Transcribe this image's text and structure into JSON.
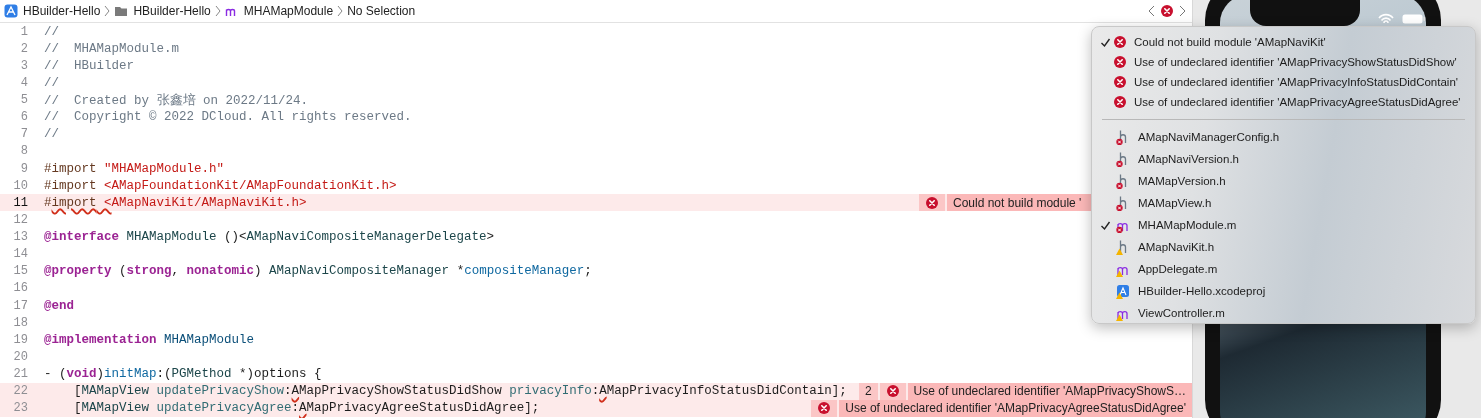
{
  "breadcrumb": {
    "items": [
      {
        "label": "HBuilder-Hello",
        "kind": "project"
      },
      {
        "label": "HBuilder-Hello",
        "kind": "folder"
      },
      {
        "label": "MHAMapModule",
        "kind": "source"
      },
      {
        "label": "No Selection",
        "kind": "symbol"
      }
    ]
  },
  "editor": {
    "lines": [
      {
        "number": "1",
        "current": false,
        "error": false,
        "segments": [
          {
            "text": "//",
            "kind": "comment"
          }
        ]
      },
      {
        "number": "2",
        "current": false,
        "error": false,
        "segments": [
          {
            "text": "//  MHAMapModule.m",
            "kind": "comment"
          }
        ]
      },
      {
        "number": "3",
        "current": false,
        "error": false,
        "segments": [
          {
            "text": "//  HBuilder",
            "kind": "comment"
          }
        ]
      },
      {
        "number": "4",
        "current": false,
        "error": false,
        "segments": [
          {
            "text": "//",
            "kind": "comment"
          }
        ]
      },
      {
        "number": "5",
        "current": false,
        "error": false,
        "segments": [
          {
            "text": "//  Created by 张鑫培 on 2022/11/24.",
            "kind": "comment"
          }
        ]
      },
      {
        "number": "6",
        "current": false,
        "error": false,
        "segments": [
          {
            "text": "//  Copyright © 2022 DCloud. All rights reserved.",
            "kind": "comment"
          }
        ]
      },
      {
        "number": "7",
        "current": false,
        "error": false,
        "segments": [
          {
            "text": "//",
            "kind": "comment"
          }
        ]
      },
      {
        "number": "8",
        "current": false,
        "error": false
      },
      {
        "number": "9",
        "current": false,
        "error": false,
        "segments": [
          {
            "text": "#import ",
            "kind": "preproc"
          },
          {
            "text": "\"MHAMapModule.h\"",
            "kind": "string"
          }
        ]
      },
      {
        "number": "10",
        "current": false,
        "error": false,
        "segments": [
          {
            "text": "#import ",
            "kind": "preproc"
          },
          {
            "text": "<AMapFoundationKit/AMapFoundationKit.h>",
            "kind": "string"
          }
        ]
      },
      {
        "number": "11",
        "current": true,
        "error": true,
        "segments": [
          {
            "text": "#",
            "kind": "preproc"
          },
          {
            "text": "import",
            "kind": "preproc_squiggle"
          },
          {
            "text": " <",
            "kind": "string_squiggle"
          },
          {
            "text": "AMapNaviKit/",
            "kind": "string"
          },
          {
            "text": "AMapNaviKit",
            "kind": "string_selected"
          },
          {
            "text": ".h>",
            "kind": "string"
          }
        ],
        "annotation": {
          "message": "Could not build module '"
        }
      },
      {
        "number": "12",
        "current": false,
        "error": false
      },
      {
        "number": "13",
        "current": false,
        "error": false,
        "segments": [
          {
            "text": "@interface",
            "kind": "keyword"
          },
          {
            "text": " MHAMapModule",
            "kind": "type"
          },
          {
            "text": " ()<",
            "kind": "plain"
          },
          {
            "text": "AMapNaviCompositeManagerDelegate",
            "kind": "type"
          },
          {
            "text": ">",
            "kind": "plain"
          }
        ]
      },
      {
        "number": "14",
        "current": false,
        "error": false
      },
      {
        "number": "15",
        "current": false,
        "error": false,
        "segments": [
          {
            "text": "@property",
            "kind": "keyword"
          },
          {
            "text": " (",
            "kind": "plain"
          },
          {
            "text": "strong",
            "kind": "keyword"
          },
          {
            "text": ", ",
            "kind": "plain"
          },
          {
            "text": "nonatomic",
            "kind": "keyword"
          },
          {
            "text": ") ",
            "kind": "plain"
          },
          {
            "text": "AMapNaviCompositeManager",
            "kind": "type"
          },
          {
            "text": " *",
            "kind": "plain"
          },
          {
            "text": "compositeManager",
            "kind": "ident"
          },
          {
            "text": ";",
            "kind": "plain"
          }
        ]
      },
      {
        "number": "16",
        "current": false,
        "error": false
      },
      {
        "number": "17",
        "current": false,
        "error": false,
        "segments": [
          {
            "text": "@end",
            "kind": "keyword"
          }
        ]
      },
      {
        "number": "18",
        "current": false,
        "error": false
      },
      {
        "number": "19",
        "current": false,
        "error": false,
        "segments": [
          {
            "text": "@implementation",
            "kind": "keyword"
          },
          {
            "text": " MHAMapModule",
            "kind": "class"
          }
        ]
      },
      {
        "number": "20",
        "current": false,
        "error": false
      },
      {
        "number": "21",
        "current": false,
        "error": false,
        "segments": [
          {
            "text": "- (",
            "kind": "plain"
          },
          {
            "text": "void",
            "kind": "keyword"
          },
          {
            "text": ")",
            "kind": "plain"
          },
          {
            "text": "initMap",
            "kind": "ident"
          },
          {
            "text": ":(",
            "kind": "plain"
          },
          {
            "text": "PGMethod",
            "kind": "type"
          },
          {
            "text": " *)options {",
            "kind": "plain"
          }
        ]
      },
      {
        "number": "22",
        "current": false,
        "error": true,
        "segments": [
          {
            "text": "    [",
            "kind": "plain"
          },
          {
            "text": "MAMapView",
            "kind": "type"
          },
          {
            "text": " updatePrivacyShow",
            "kind": "method"
          },
          {
            "text": ":",
            "kind": "plain"
          },
          {
            "text": "A",
            "kind": "plain_squiggle"
          },
          {
            "text": "MapPrivacyShowStatusDidShow ",
            "kind": "plain"
          },
          {
            "text": "privacyInfo",
            "kind": "method"
          },
          {
            "text": ":",
            "kind": "plain"
          },
          {
            "text": "A",
            "kind": "plain_squiggle"
          },
          {
            "text": "MapPrivacyInfoStatusDidContain];",
            "kind": "plain"
          }
        ],
        "annotation": {
          "count": "2",
          "message": "Use of undeclared identifier 'AMapPrivacyShowS…"
        }
      },
      {
        "number": "23",
        "current": false,
        "error": true,
        "segments": [
          {
            "text": "    [",
            "kind": "plain"
          },
          {
            "text": "MAMapView",
            "kind": "type"
          },
          {
            "text": " updatePrivacyAgree",
            "kind": "method"
          },
          {
            "text": ":",
            "kind": "plain"
          },
          {
            "text": "A",
            "kind": "plain_squiggle"
          },
          {
            "text": "MapPrivacyAgreeStatusDidAgree];",
            "kind": "plain"
          }
        ],
        "annotation": {
          "message": "Use of undeclared identifier 'AMapPrivacyAgreeStatusDidAgree'"
        }
      }
    ]
  },
  "issue_menu": {
    "issues": [
      {
        "message": "Could not build module 'AMapNaviKit'",
        "checked": true
      },
      {
        "message": "Use of undeclared identifier 'AMapPrivacyShowStatusDidShow'",
        "checked": false
      },
      {
        "message": "Use of undeclared identifier 'AMapPrivacyInfoStatusDidContain'",
        "checked": false
      },
      {
        "message": "Use of undeclared identifier 'AMapPrivacyAgreeStatusDidAgree'",
        "checked": false
      }
    ],
    "files": [
      {
        "name": "AMapNaviManagerConfig.h",
        "kind": "header_error",
        "checked": false
      },
      {
        "name": "AMapNaviVersion.h",
        "kind": "header_error",
        "checked": false
      },
      {
        "name": "MAMapVersion.h",
        "kind": "header_error",
        "checked": false
      },
      {
        "name": "MAMapView.h",
        "kind": "header_error",
        "checked": false
      },
      {
        "name": "MHAMapModule.m",
        "kind": "objc_error",
        "checked": true
      },
      {
        "name": "AMapNaviKit.h",
        "kind": "header_warning",
        "checked": false
      },
      {
        "name": "AppDelegate.m",
        "kind": "objc_warning",
        "checked": false
      },
      {
        "name": "HBuilder-Hello.xcodeproj",
        "kind": "project_warning",
        "checked": false
      },
      {
        "name": "ViewController.m",
        "kind": "objc_warning",
        "checked": false
      }
    ]
  }
}
